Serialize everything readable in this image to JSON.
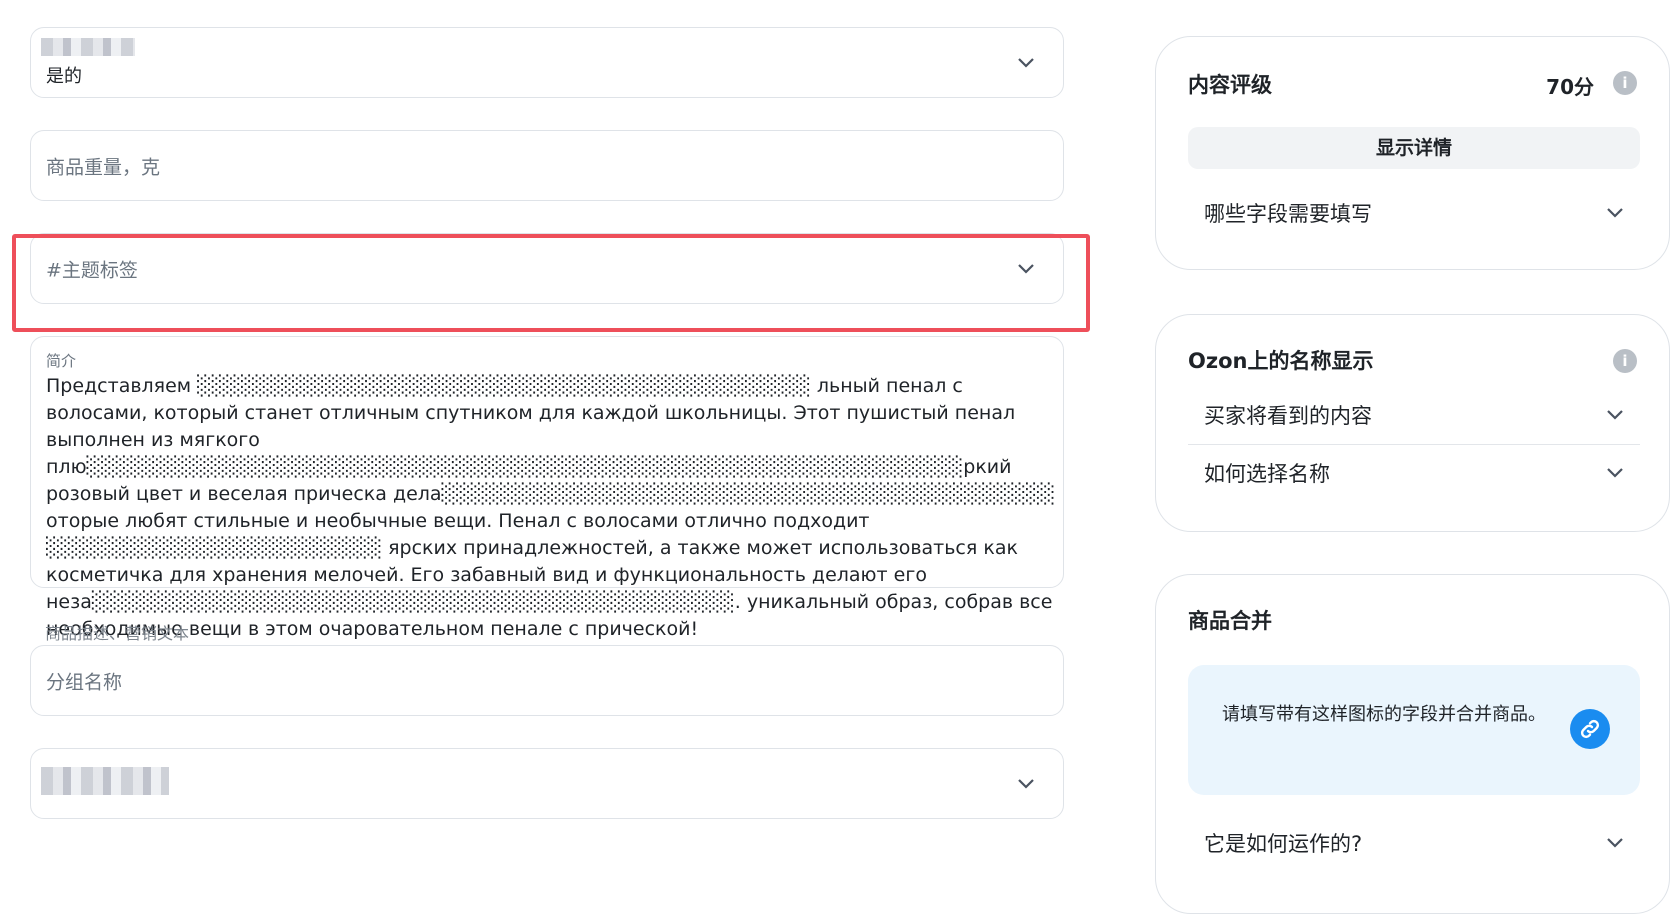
{
  "form": {
    "field1": {
      "value": "是的"
    },
    "weight": {
      "placeholder": "商品重量，克"
    },
    "hashtags": {
      "placeholder": "#主题标签"
    },
    "description": {
      "label": "简介",
      "text": "Представляем ░░░░░░░░░░░░░░░░░░░░░░░░░░░░░░░░░░░░░░░░░░ льный пенал с волосами, который станет отличным спутником для каждой школьницы. Этот пушистый пенал выполнен из мягкого плю░░░░░░░░░░░░░░░░░░░░░░░░░░░░░░░░░░░░░░░░░░░░░░░░░░░░░░░░░░░░ркий розовый цвет и веселая прическа дела░░░░░░░░░░░░░░░░░░░░░░░░░░░░░░░░░░░░░░░░░░ оторые любят стильные и необычные вещи. Пенал с волосами отлично подходит ░░░░░░░░░░░░░░░░░░░░░░░ ярских принадлежностей, а также может использоваться как косметичка для хранения мелочей. Его забавный вид и функциональность делают его неза░░░░░░░░░░░░░░░░░░░░░░░░░░░░░░░░░░░░░░░░░░░░. уникальный образ, собрав все необходимые вещи в этом очаровательном пенале с прической!",
      "helper": "商品描述、营销文本"
    },
    "group": {
      "placeholder": "分组名称"
    }
  },
  "rating_card": {
    "title": "内容评级",
    "score": "70分",
    "details_button": "显示详情",
    "required_fields": "哪些字段需要填写"
  },
  "name_card": {
    "title": "Ozon上的名称显示",
    "buyer_sees": "买家将看到的内容",
    "how_choose": "如何选择名称"
  },
  "merge_card": {
    "title": "商品合并",
    "notice": "请填写带有这样图标的字段并合并商品。",
    "how_it_works": "它是如何运作的?"
  },
  "colors": {
    "highlight": "#ee4f5a",
    "merge_icon": "#1a8cf0",
    "info_icon": "#b9bfc6"
  }
}
